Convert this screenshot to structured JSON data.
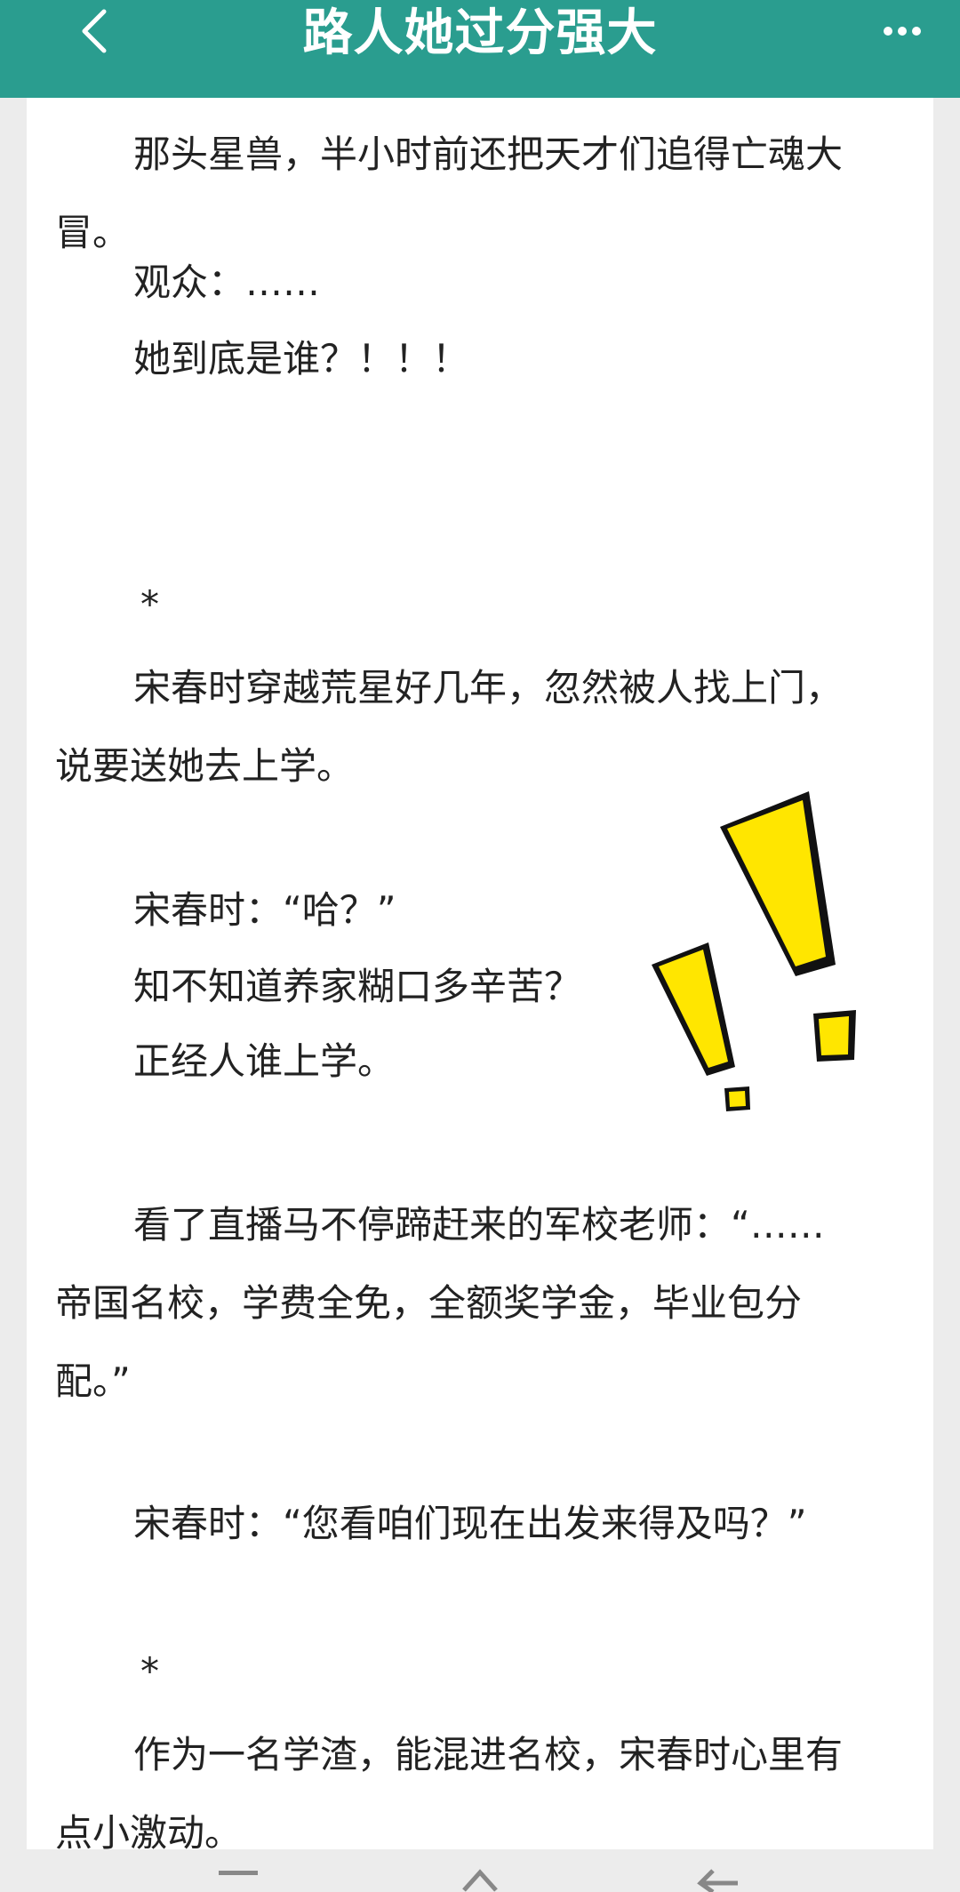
{
  "header": {
    "title": "路人她过分强大",
    "back_icon": "chevron-left-icon",
    "more_icon": "more-dots-icon",
    "background": "#2a9d8f"
  },
  "content": {
    "p1_line1": "那头星兽，半小时前还把天才们追得亡魂大",
    "p1_line2": "冒。",
    "p2": "观众：……",
    "p3": "她到底是谁？！！！",
    "star1": "*",
    "p4_line1": "宋春时穿越荒星好几年，忽然被人找上门，",
    "p4_line2": "说要送她去上学。",
    "p5": "宋春时：“哈？”",
    "p6": "知不知道养家糊口多辛苦？",
    "p7": "正经人谁上学。",
    "p8_line1": "看了直播马不停蹄赶来的军校老师：“……",
    "p8_line2": "帝国名校，学费全免，全额奖学金，毕业包分",
    "p8_line3": "配。”",
    "p9": "宋春时：“您看咱们现在出发来得及吗？”",
    "star2": "*",
    "p10_line1": "作为一名学渣，能混进名校，宋春时心里有",
    "p10_line2": "点小激动。"
  },
  "decoration": {
    "sticker": "double-exclamation-sticker",
    "sticker_color": "#ffe600"
  },
  "bottom_nav": {
    "items": [
      "menu-icon",
      "home-icon",
      "back-icon"
    ]
  }
}
